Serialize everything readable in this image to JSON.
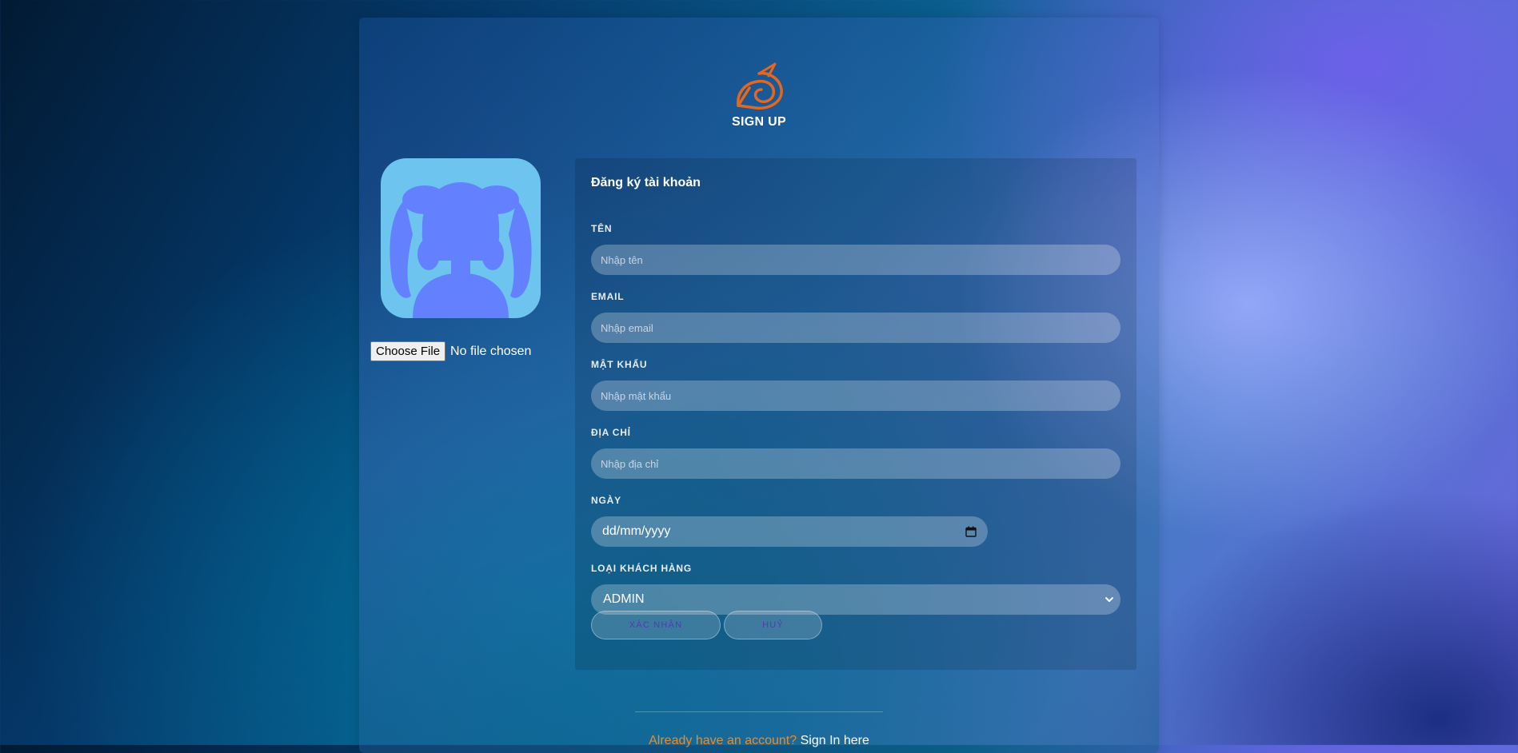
{
  "header": {
    "title": "SIGN UP",
    "logo_icon": "leaf-village-swirl-icon",
    "logo_color": "#e8661c"
  },
  "avatar": {
    "icon": "anime-girl-silhouette-icon",
    "bg_color": "#6cc4ef",
    "silhouette_color": "#6381ff"
  },
  "file_input": {
    "button_label": "Choose File",
    "status": "No file chosen"
  },
  "form": {
    "title": "Đăng ký tài khoản",
    "fields": {
      "name": {
        "label": "TÊN",
        "placeholder": "Nhập tên"
      },
      "email": {
        "label": "EMAIL",
        "placeholder": "Nhập email"
      },
      "password": {
        "label": "MẬT KHẨU",
        "placeholder": "Nhập mật khẩu"
      },
      "address": {
        "label": "ĐỊA CHỈ",
        "placeholder": "Nhập địa chỉ"
      },
      "date": {
        "label": "NGÀY",
        "value": "dd/mm/yyyy",
        "icon": "calendar-icon"
      },
      "customer_type": {
        "label": "LOẠI KHÁCH HÀNG",
        "selected": "ADMIN",
        "icon": "chevron-down-icon"
      }
    },
    "buttons": {
      "confirm": "XÁC NHẬN",
      "cancel": "HUỶ"
    }
  },
  "footer": {
    "question": "Already have an account?",
    "link": "Sign In here",
    "question_color": "#f08a24"
  }
}
